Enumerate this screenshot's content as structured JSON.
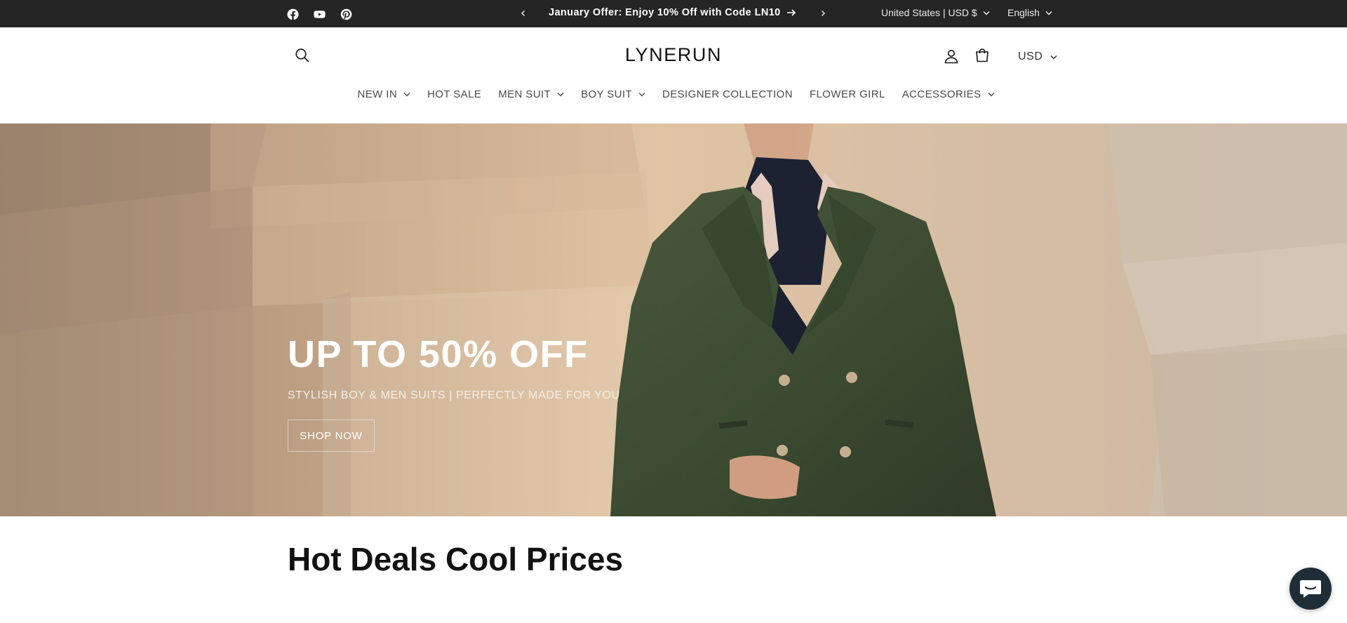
{
  "topbar": {
    "social": [
      {
        "name": "facebook-icon"
      },
      {
        "name": "youtube-icon"
      },
      {
        "name": "pinterest-icon"
      }
    ],
    "announcement": "January Offer: Enjoy 10% Off with Code LN10",
    "country": "United States | USD $",
    "language": "English",
    "colors": {
      "background": "#252525",
      "text": "#ffffff"
    }
  },
  "header": {
    "logo": "LYNERUN",
    "currency": "USD",
    "icons": [
      "search-icon",
      "account-icon",
      "cart-icon"
    ]
  },
  "nav": {
    "items": [
      {
        "label": "NEW IN",
        "has_dropdown": true
      },
      {
        "label": "HOT SALE",
        "has_dropdown": false
      },
      {
        "label": "MEN SUIT",
        "has_dropdown": true
      },
      {
        "label": "BOY SUIT",
        "has_dropdown": true
      },
      {
        "label": "DESIGNER COLLECTION",
        "has_dropdown": false
      },
      {
        "label": "FLOWER GIRL",
        "has_dropdown": false
      },
      {
        "label": "ACCESSORIES",
        "has_dropdown": true
      }
    ]
  },
  "hero": {
    "title": "UP TO 50% OFF",
    "subtitle": "STYLISH BOY & MEN SUITS | PERFECTLY MADE FOR YOU",
    "button": "SHOP NOW"
  },
  "section": {
    "title": "Hot Deals Cool Prices"
  },
  "chat": {
    "icon": "chat-icon",
    "color": "#1f2d36"
  }
}
